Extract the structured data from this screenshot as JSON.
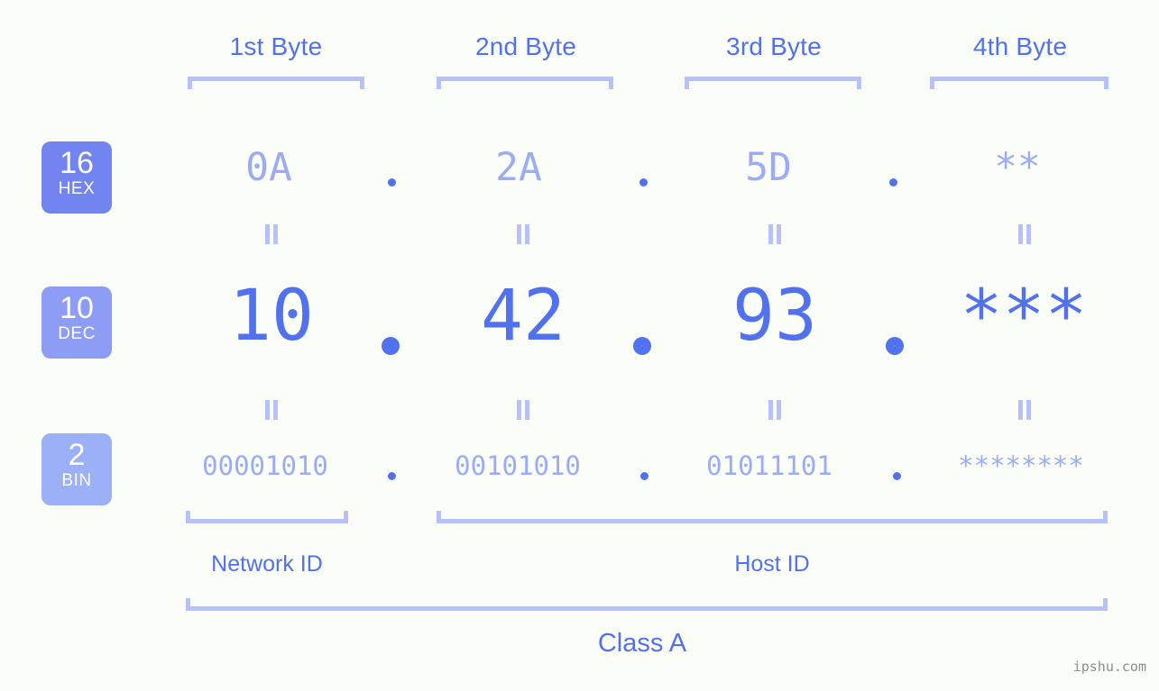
{
  "page": {
    "background_color": "#fbfdf9",
    "accent_color": "#5271ee",
    "accent_light_color": "#9bacf7",
    "bracket_color": "#b6c0fb",
    "watermark": "ipshu.com"
  },
  "byte_headers": [
    {
      "label": "1st Byte"
    },
    {
      "label": "2nd Byte"
    },
    {
      "label": "3rd Byte"
    },
    {
      "label": "4th Byte"
    }
  ],
  "bases": [
    {
      "number": "16",
      "name": "HEX",
      "color": "#7184ef"
    },
    {
      "number": "10",
      "name": "DEC",
      "color": "#8d9cf4"
    },
    {
      "number": "2",
      "name": "BIN",
      "color": "#9bb0f6"
    }
  ],
  "rows": {
    "hex": {
      "base": "16",
      "name": "HEX",
      "values": [
        "0A",
        "2A",
        "5D",
        "**"
      ]
    },
    "dec": {
      "base": "10",
      "name": "DEC",
      "values": [
        "10",
        "42",
        "93",
        "***"
      ]
    },
    "bin": {
      "base": "2",
      "name": "BIN",
      "values": [
        "00001010",
        "00101010",
        "01011101",
        "********"
      ]
    }
  },
  "separator": ".",
  "equals_symbol": "=",
  "sections": [
    {
      "label": "Network ID"
    },
    {
      "label": "Host ID"
    }
  ],
  "class": {
    "label": "Class A"
  }
}
